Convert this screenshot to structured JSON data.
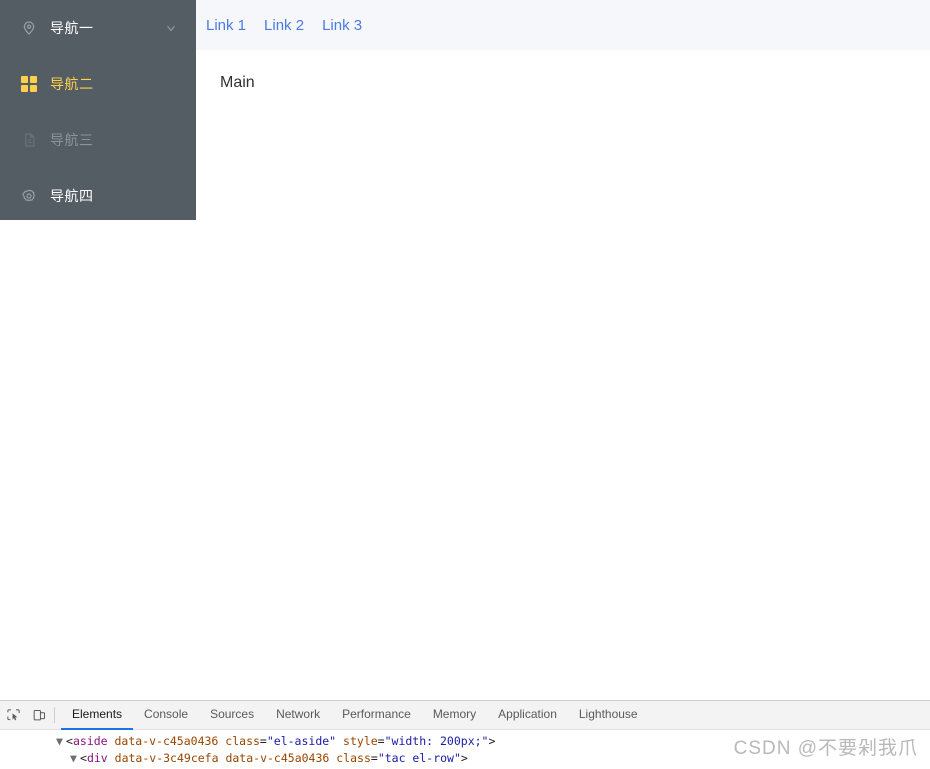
{
  "sidebar": {
    "background_color": "#545c64",
    "active_text_color": "#ffd04b",
    "items": [
      {
        "icon": "location-pin-icon",
        "label": "导航一",
        "state": "default",
        "has_arrow": true,
        "arrow_icon": "chevron-down-icon"
      },
      {
        "icon": "grid-menu-icon",
        "label": "导航二",
        "state": "active",
        "has_arrow": false
      },
      {
        "icon": "document-icon",
        "label": "导航三",
        "state": "disabled",
        "has_arrow": false
      },
      {
        "icon": "gear-icon",
        "label": "导航四",
        "state": "default",
        "has_arrow": false
      }
    ]
  },
  "header": {
    "background_color": "#f6f7fb",
    "link_color": "#4a7be0",
    "links": [
      {
        "label": "Link 1"
      },
      {
        "label": "Link 2"
      },
      {
        "label": "Link 3"
      }
    ]
  },
  "main": {
    "text": "Main"
  },
  "devtools": {
    "toolbar": {
      "inspect_icon": "inspect-element-icon",
      "device_icon": "device-toolbar-icon"
    },
    "accent_color": "#1a73e8",
    "tabs": [
      {
        "label": "Elements",
        "active": true
      },
      {
        "label": "Console",
        "active": false
      },
      {
        "label": "Sources",
        "active": false
      },
      {
        "label": "Network",
        "active": false
      },
      {
        "label": "Performance",
        "active": false
      },
      {
        "label": "Memory",
        "active": false
      },
      {
        "label": "Application",
        "active": false
      },
      {
        "label": "Lighthouse",
        "active": false
      }
    ],
    "dom_lines": [
      {
        "indent": 1,
        "triangle": "▼",
        "tag": "aside",
        "attrs": [
          {
            "name": "data-v-c45a0436",
            "value": null
          },
          {
            "name": "class",
            "value": "el-aside"
          },
          {
            "name": "style",
            "value": "width: 200px;"
          }
        ]
      },
      {
        "indent": 2,
        "triangle": "▼",
        "tag": "div",
        "attrs": [
          {
            "name": "data-v-3c49cefa",
            "value": null
          },
          {
            "name": "data-v-c45a0436",
            "value": null
          },
          {
            "name": "class",
            "value": "tac el-row"
          }
        ]
      }
    ]
  },
  "watermark": {
    "text": "CSDN @不要剁我爪"
  }
}
